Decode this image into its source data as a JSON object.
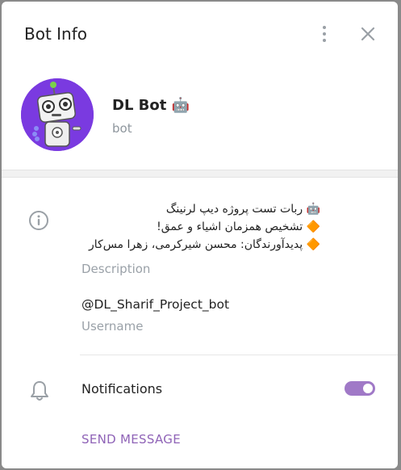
{
  "header": {
    "title": "Bot Info",
    "menu_icon": "more-vertical-icon",
    "close_icon": "close-icon"
  },
  "profile": {
    "name": "DL Bot",
    "name_emoji": "🤖",
    "subtitle": "bot",
    "avatar_icon": "robot-avatar-icon"
  },
  "info": {
    "icon": "info-icon",
    "description_lines": [
      "🤖 ربات تست پروژه دیپ لرنینگ",
      "🔶 تشخیص همزمان اشیاء و عمق!",
      "🔶 پدیدآورندگان: محسن شیرکرمی، زهرا مس‌کار"
    ],
    "description_label": "Description",
    "username": "@DL_Sharif_Project_bot",
    "username_label": "Username"
  },
  "notifications": {
    "icon": "bell-icon",
    "label": "Notifications",
    "enabled": true
  },
  "actions": {
    "send_message": "SEND MESSAGE"
  },
  "colors": {
    "accent": "#8f63b7",
    "toggle": "#a079c7",
    "avatar_bg": "#7a3ae0"
  }
}
